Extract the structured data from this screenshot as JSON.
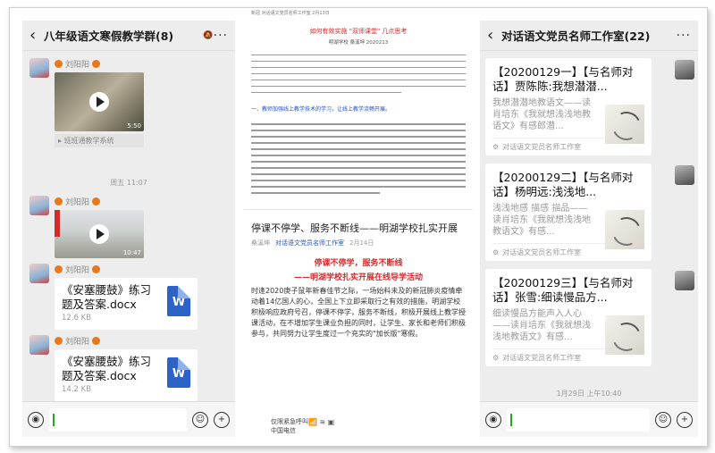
{
  "left_chat": {
    "title": "八年级语文寒假教学群(8)",
    "messages": [
      {
        "sender": "刘阳阳",
        "type": "video",
        "duration": "5:50",
        "source": "班班通教学系统"
      },
      {
        "sender": "刘阳阳",
        "type": "video",
        "duration": "10:47"
      },
      {
        "sender": "刘阳阳",
        "type": "file",
        "filename": "《安塞腰鼓》练习题及答案.docx",
        "size": "12.6 KB"
      },
      {
        "sender": "刘阳阳",
        "type": "file",
        "filename": "《安塞腰鼓》练习题及答案.docx",
        "size": "14.2 KB"
      }
    ],
    "time_divider": "周五 11:07"
  },
  "document": {
    "crumb": "新冠  对话语文党员名师工作室  2月13日",
    "top_title": "如何有效实施 \"双师课堂\" 几点思考",
    "top_meta": "明湖学校  桑溪坤  2020213",
    "blue_heading": "一、教师加强线上教学技术的学习，让线上教学流畅开展。",
    "article_title": "停课不停学、服务不断线——明湖学校扎实开展",
    "article_author": "桑溪坤",
    "article_account": "对话语文党员名师工作室",
    "article_date": "2月14日",
    "heading_1": "停课不停学，服务不断线",
    "heading_2": "——明湖学校扎实开展在线导学活动",
    "paragraph": "时逢2020庚子鼠年新春佳节之际，一场始料未及的新冠肺炎疫情牵动着14亿国人的心，全国上下立即采取行之有效的措施，明湖学校积极响应政府号召，停课不停学，服务不断线，积极开展线上教学授课活动，在不增加学生课业负担的同时，让学生、家长和老师们积极参与，共同努力让学生度过一个充实的\"加长版\"寒假。",
    "status_text": "仅限紧急呼叫",
    "carrier": "中国电信"
  },
  "right_chat": {
    "title": "对话语文党员名师工作室(22)",
    "cards": [
      {
        "title": "【20200129一】【与名师对话】贾陈陈:我想潜潜...",
        "desc": "我想潜潜地教语文——读肖培东《我就想浅浅地教语文》有感郎潜...",
        "source": "对话语文党员名师工作室"
      },
      {
        "title": "【20200129二】【与名师对话】杨明远:浅浅地...",
        "desc": "浅浅地感 描感 描品——读肖培东《我就想浅浅地教语文》有感...",
        "source": "对话语文党员名师工作室"
      },
      {
        "title": "【20200129三】【与名师对话】张雪:细读慢品方...",
        "desc": "细读慢品方能声入人心——读肖培东《我就想浅浅地教语文》有感...",
        "source": "对话语文党员名师工作室"
      }
    ],
    "time_divider": "1月29日 上午10:40"
  }
}
